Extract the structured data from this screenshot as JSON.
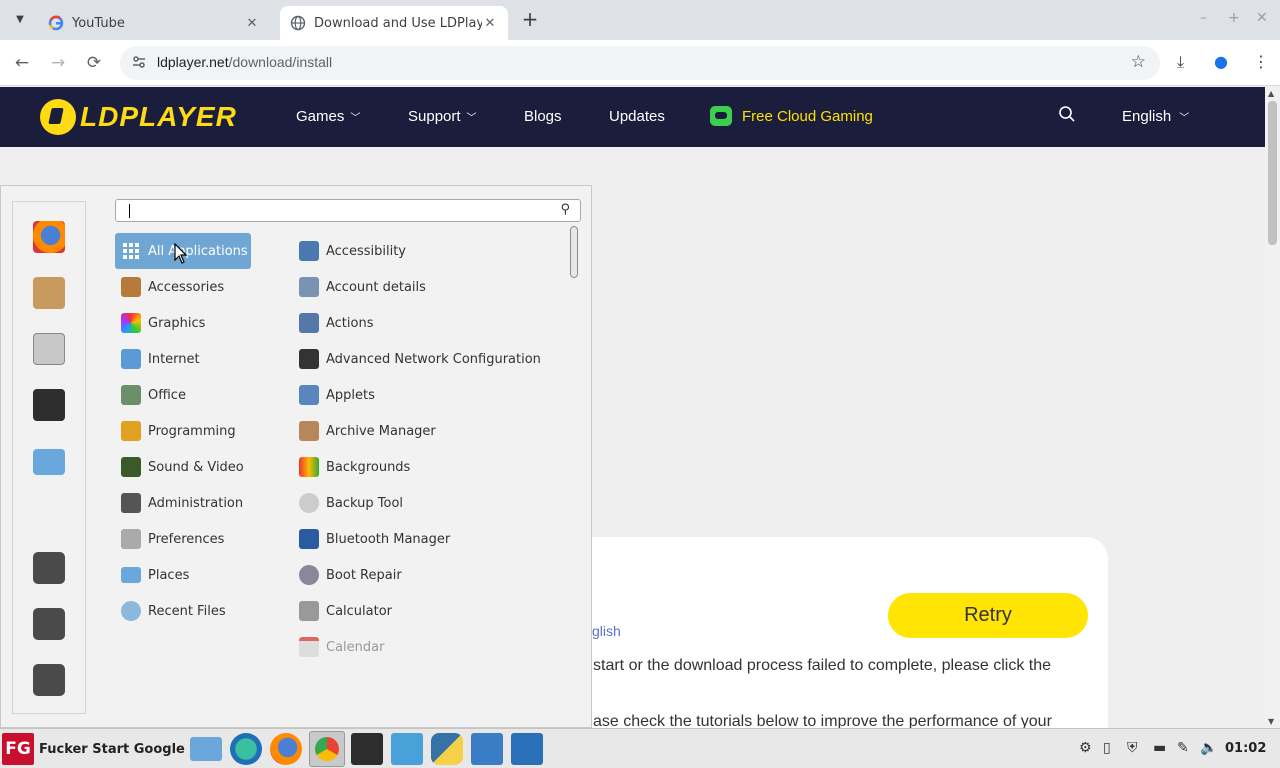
{
  "browser": {
    "tabs": [
      {
        "title": "YouTube",
        "icon": "google-g-icon",
        "active": false
      },
      {
        "title": "Download and Use LDPlayer",
        "icon": "globe-icon",
        "active": true
      }
    ],
    "url_host": "ldplayer.net",
    "url_path": "/download/install",
    "controls": {
      "back": "←",
      "forward": "→",
      "reload": "⟳",
      "new_tab": "+",
      "close": "✕",
      "minimize": "–",
      "maximize": "+",
      "win_close": "✕",
      "star": "☆",
      "download": "⤓",
      "profile": "●",
      "more": "⋮"
    }
  },
  "site_nav": {
    "logo": "LDPLAYER",
    "links": [
      {
        "label": "Games",
        "chevron": true
      },
      {
        "label": "Support",
        "chevron": true
      },
      {
        "label": "Blogs",
        "chevron": false
      },
      {
        "label": "Updates",
        "chevron": false
      }
    ],
    "cloud_gaming": "Free Cloud Gaming",
    "language": "English",
    "colors": {
      "nav_bg": "#1b1d3c",
      "logo": "#ffdb11",
      "cloud": "#ffe000"
    }
  },
  "page": {
    "retry_label": "Retry",
    "lang_link_fragment": "glish",
    "text_line_1": "start or the download process failed to complete, please click the",
    "text_line_2": "ase check the tutorials below to improve the performance of your"
  },
  "start_menu": {
    "search_placeholder": "",
    "categories": [
      {
        "label": "All Applications",
        "icon": "grid-icon",
        "selected": true
      },
      {
        "label": "Accessories",
        "icon": "calculator-icon"
      },
      {
        "label": "Graphics",
        "icon": "color-wheel-icon"
      },
      {
        "label": "Internet",
        "icon": "network-icon"
      },
      {
        "label": "Office",
        "icon": "office-icon"
      },
      {
        "label": "Programming",
        "icon": "construction-icon"
      },
      {
        "label": "Sound & Video",
        "icon": "film-icon"
      },
      {
        "label": "Administration",
        "icon": "admin-gear-icon"
      },
      {
        "label": "Preferences",
        "icon": "sliders-icon"
      },
      {
        "label": "Places",
        "icon": "folder-icon"
      },
      {
        "label": "Recent Files",
        "icon": "recent-icon"
      }
    ],
    "apps": [
      {
        "label": "Accessibility",
        "icon": "accessibility-icon"
      },
      {
        "label": "Account details",
        "icon": "account-icon"
      },
      {
        "label": "Actions",
        "icon": "actions-icon"
      },
      {
        "label": "Advanced Network Configuration",
        "icon": "network-config-icon"
      },
      {
        "label": "Applets",
        "icon": "applets-icon"
      },
      {
        "label": "Archive Manager",
        "icon": "archive-icon"
      },
      {
        "label": "Backgrounds",
        "icon": "backgrounds-icon"
      },
      {
        "label": "Backup Tool",
        "icon": "backup-icon"
      },
      {
        "label": "Bluetooth Manager",
        "icon": "bluetooth-icon"
      },
      {
        "label": "Boot Repair",
        "icon": "boot-repair-icon"
      },
      {
        "label": "Calculator",
        "icon": "calculator-icon"
      },
      {
        "label": "Calendar",
        "icon": "calendar-icon",
        "dim": true
      }
    ],
    "sidebar": [
      "firefox-icon",
      "package-icon",
      "settings-icon",
      "terminal-icon",
      "folder-icon",
      "lock-icon",
      "logout-icon",
      "power-icon"
    ]
  },
  "taskbar": {
    "start_label": "Fucker Start Google",
    "start_badge": "FG",
    "apps": [
      "file-manager-icon",
      "edge-dev-icon",
      "firefox-icon",
      "chrome-icon",
      "terminal-icon",
      "snowflake-icon",
      "python-icon",
      "system-monitor-icon",
      "tools-icon"
    ],
    "tray": [
      "network-icon",
      "clipboard-icon",
      "shield-icon",
      "keyboard-icon",
      "pen-icon",
      "volume-icon"
    ],
    "clock": "01:02"
  }
}
